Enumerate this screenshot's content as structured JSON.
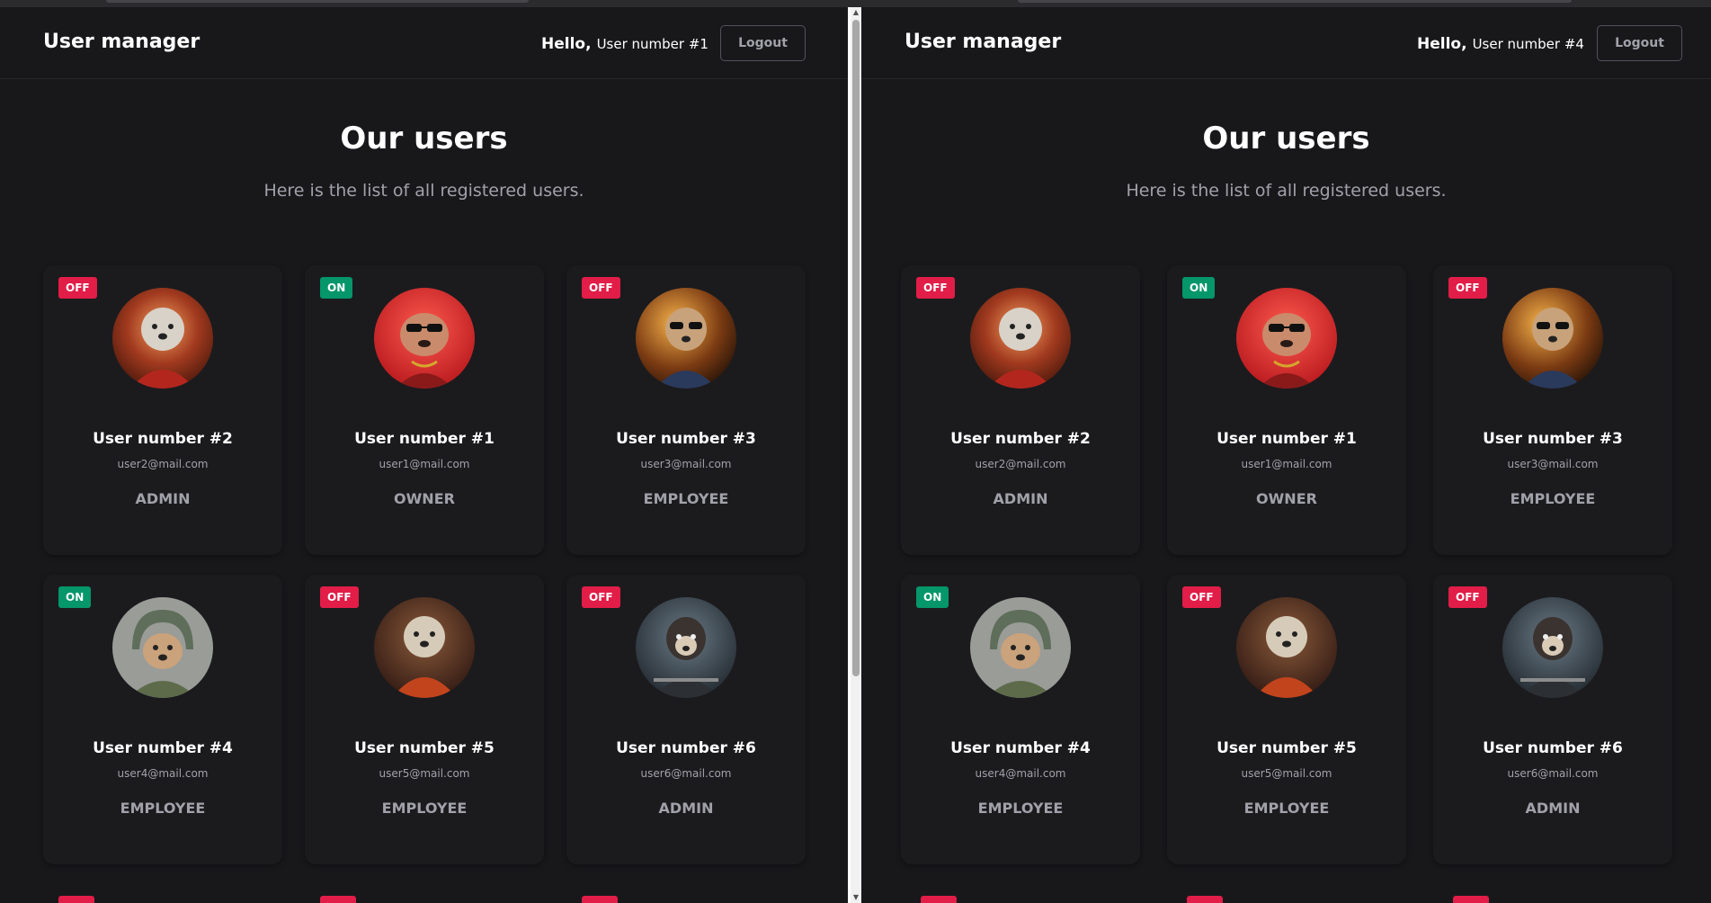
{
  "app": {
    "brand": "User manager",
    "greeting": "Hello,",
    "logout_label": "Logout",
    "page_title": "Our users",
    "page_subtitle": "Here is the list of all registered users."
  },
  "windows": [
    {
      "current_user": "User number #1"
    },
    {
      "current_user": "User number #4"
    }
  ],
  "users": [
    {
      "name": "User number #2",
      "email": "user2@mail.com",
      "role": "ADMIN",
      "status": "OFF",
      "avatar": "dog-red-leather-jacket-avatar"
    },
    {
      "name": "User number #1",
      "email": "user1@mail.com",
      "role": "OWNER",
      "status": "ON",
      "avatar": "bulldog-sunglasses-red-avatar"
    },
    {
      "name": "User number #3",
      "email": "user3@mail.com",
      "role": "EMPLOYEE",
      "status": "OFF",
      "avatar": "dog-sunglasses-biker-avatar"
    },
    {
      "name": "User number #4",
      "email": "user4@mail.com",
      "role": "EMPLOYEE",
      "status": "ON",
      "avatar": "dog-helmet-avatar"
    },
    {
      "name": "User number #5",
      "email": "user5@mail.com",
      "role": "EMPLOYEE",
      "status": "OFF",
      "avatar": "dog-orange-jacket-avatar"
    },
    {
      "name": "User number #6",
      "email": "user6@mail.com",
      "role": "ADMIN",
      "status": "OFF",
      "avatar": "dog-motorcycle-avatar"
    }
  ],
  "theme": {
    "background": "#18181b",
    "card": "#1b1b1e",
    "status_on": "#059669",
    "status_off": "#e11d48",
    "muted_text": "#a1a1aa"
  }
}
